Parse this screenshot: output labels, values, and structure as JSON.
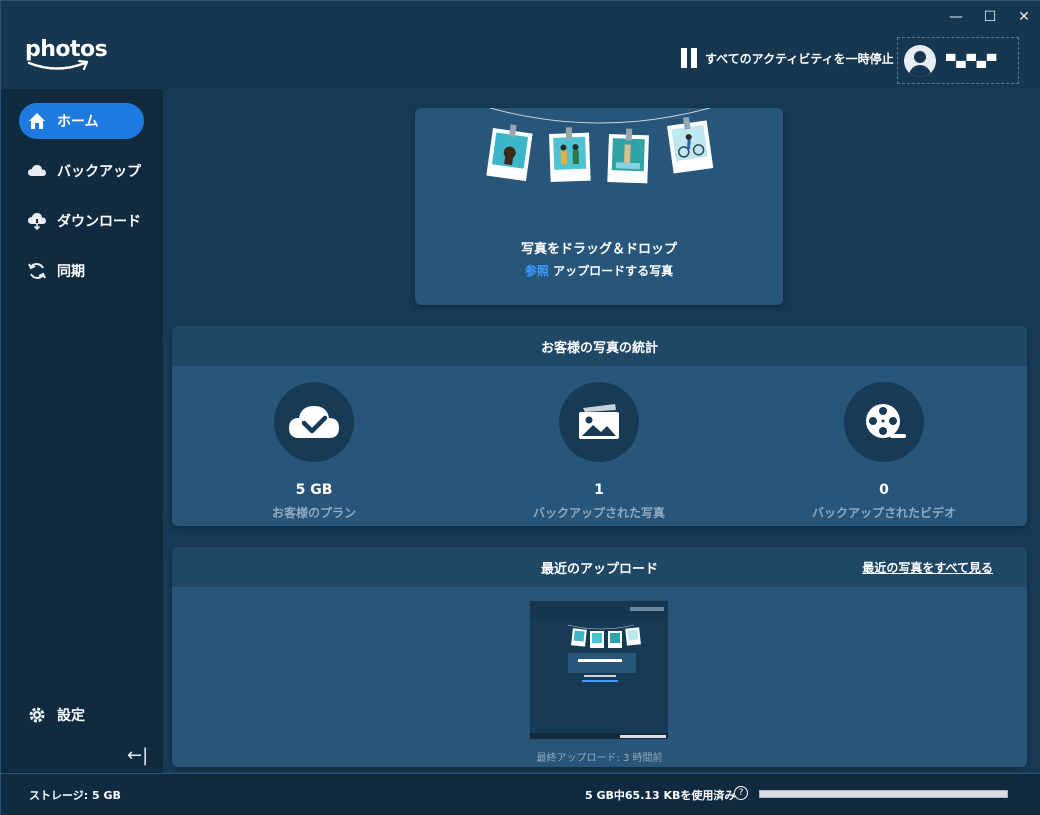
{
  "header": {
    "logo_text": "photos",
    "pause_label": "すべてのアクティビティを一時停止",
    "user_name": "▀▄▀▄▀"
  },
  "window_controls": {
    "minimize": "—",
    "maximize": "☐",
    "close": "✕"
  },
  "sidebar": {
    "items": [
      {
        "label": "ホーム",
        "icon": "home-icon",
        "active": true
      },
      {
        "label": "バックアップ",
        "icon": "cloud-icon",
        "active": false
      },
      {
        "label": "ダウンロード",
        "icon": "cloud-download-icon",
        "active": false
      },
      {
        "label": "同期",
        "icon": "sync-icon",
        "active": false
      }
    ],
    "settings_label": "設定",
    "collapse_glyph": "←|"
  },
  "drop_zone": {
    "title": "写真をドラッグ＆ドロップ",
    "browse_link": "参照",
    "subtitle_rest": " アップロードする写真"
  },
  "stats": {
    "title": "お客様の写真の統計",
    "items": [
      {
        "value": "5 GB",
        "label": "お客様のプラン",
        "icon": "cloud-check-icon"
      },
      {
        "value": "1",
        "label": "バックアップされた写真",
        "icon": "photo-icon"
      },
      {
        "value": "0",
        "label": "バックアップされたビデオ",
        "icon": "film-reel-icon"
      }
    ]
  },
  "recent": {
    "title": "最近のアップロード",
    "see_all": "最近の写真をすべて見る",
    "last_upload": "最終アップロード: 3 時間前"
  },
  "footer": {
    "storage": "ストレージ: 5 GB",
    "usage": "5 GB中65.13 KBを使用済み",
    "help": "?",
    "usage_fraction": 0.0
  },
  "colors": {
    "accent": "#1f7ae0",
    "link": "#3d9bff",
    "background": "#173a55",
    "sidebar": "#102a40",
    "card": "#27567a"
  }
}
